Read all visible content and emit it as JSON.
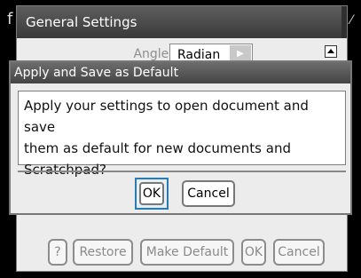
{
  "general_settings": {
    "title": "General Settings",
    "angle": {
      "label": "Angle:",
      "value": "Radian"
    },
    "buttons": {
      "help": "?",
      "restore": "Restore",
      "make_default": "Make Default",
      "ok": "OK",
      "cancel": "Cancel"
    }
  },
  "dialog": {
    "title": "Apply and Save as Default",
    "message": "Apply your settings to open document and save\nthem as default for new documents and\nScratchpad?",
    "ok": "OK",
    "cancel": "Cancel"
  },
  "colors": {
    "focus_ring": "#2b7bb2",
    "titlebar": "#4a4a4a"
  },
  "icons": {
    "scroll_up": "scroll-up-icon",
    "dropdown_arrow": "right-arrow-icon"
  }
}
